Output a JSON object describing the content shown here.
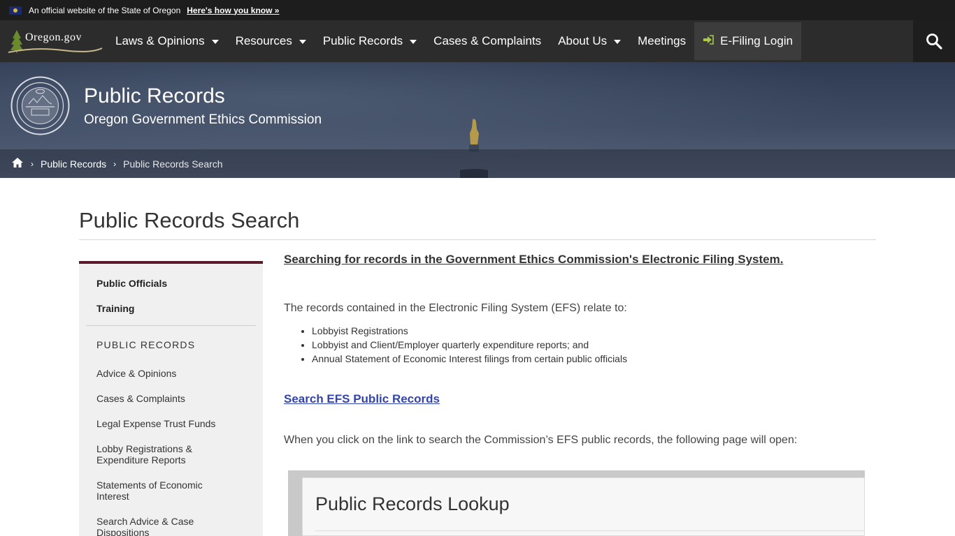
{
  "banner": {
    "official_text": "An official website of the State of Oregon",
    "how_link": "Here's how you know »"
  },
  "nav": {
    "logo_text": "Oregon.gov",
    "items": [
      {
        "label": "Laws & Opinions",
        "has_dropdown": true
      },
      {
        "label": "Resources",
        "has_dropdown": true
      },
      {
        "label": "Public Records",
        "has_dropdown": true
      },
      {
        "label": "Cases & Complaints",
        "has_dropdown": false
      },
      {
        "label": "About Us",
        "has_dropdown": true
      },
      {
        "label": "Meetings",
        "has_dropdown": false
      }
    ],
    "efiling_label": "E-Filing Login",
    "search_icon": "search-icon"
  },
  "hero": {
    "title": "Public Records",
    "subtitle": "Oregon Government Ethics Commission"
  },
  "breadcrumb": {
    "home_icon": "home-icon",
    "items": [
      "Public Records",
      "Public Records Search"
    ]
  },
  "page": {
    "title": "Public Records Search"
  },
  "sidebar": {
    "top_items": [
      "Public Officials",
      "Training"
    ],
    "heading": "PUBLIC RECORDS",
    "links": [
      "Advice & Opinions",
      "Cases & Complaints",
      "Legal Expense Trust Funds",
      "Lobby Registrations & Expenditure Reports",
      "Statements of Economic Interest",
      "Search Advice & Case Dispositions"
    ],
    "accent_color": "#5b1a2a"
  },
  "content": {
    "intro_link": "Searching for records in the Government Ethics Commission's Electronic Filing System.",
    "intro_para": "The records contained in the Electronic Filing System (EFS) relate to:",
    "bullets": [
      "Lobbyist Registrations",
      "Lobbyist and Client/Employer quarterly expenditure reports; and",
      "Annual Statement of Economic Interest filings from certain public officials"
    ],
    "search_link": "Search EFS Public Records",
    "follow_para": "When you click on the link to search the Commission’s EFS public records, the following page will open:",
    "screenshot_title": "Public Records Lookup",
    "link_color": "#3344aa"
  }
}
